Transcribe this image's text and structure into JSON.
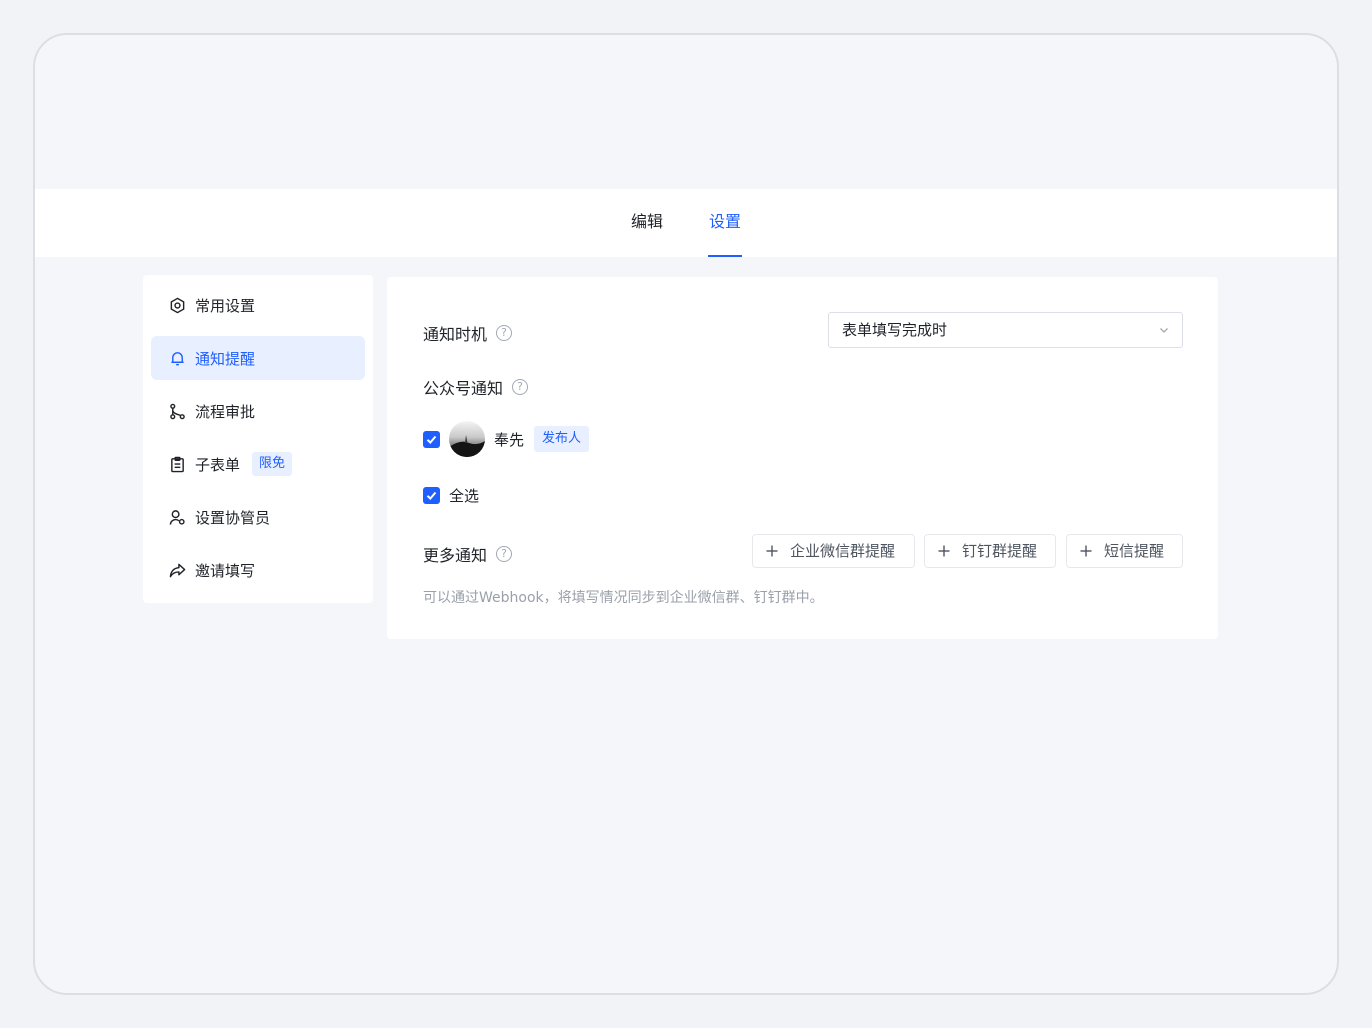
{
  "tabs": [
    {
      "label": "编辑",
      "active": false
    },
    {
      "label": "设置",
      "active": true
    }
  ],
  "sidebar": {
    "items": [
      {
        "label": "常用设置",
        "icon": "settings-hex-icon"
      },
      {
        "label": "通知提醒",
        "icon": "bell-icon",
        "active": true
      },
      {
        "label": "流程审批",
        "icon": "flow-icon"
      },
      {
        "label": "子表单",
        "icon": "clipboard-icon",
        "badge": "限免"
      },
      {
        "label": "设置协管员",
        "icon": "user-gear-icon"
      },
      {
        "label": "邀请填写",
        "icon": "share-icon"
      }
    ]
  },
  "panel": {
    "notify_timing": {
      "label": "通知时机",
      "value": "表单填写完成时"
    },
    "official_account": {
      "label": "公众号通知",
      "user_name": "奉先",
      "user_role": "发布人",
      "select_all": "全选"
    },
    "more": {
      "label": "更多通知",
      "buttons": [
        "企业微信群提醒",
        "钉钉群提醒",
        "短信提醒"
      ],
      "hint": "可以通过Webhook，将填写情况同步到企业微信群、钉钉群中。"
    }
  },
  "colors": {
    "accent": "#1f5eff",
    "accent_bg": "#e8efff"
  }
}
